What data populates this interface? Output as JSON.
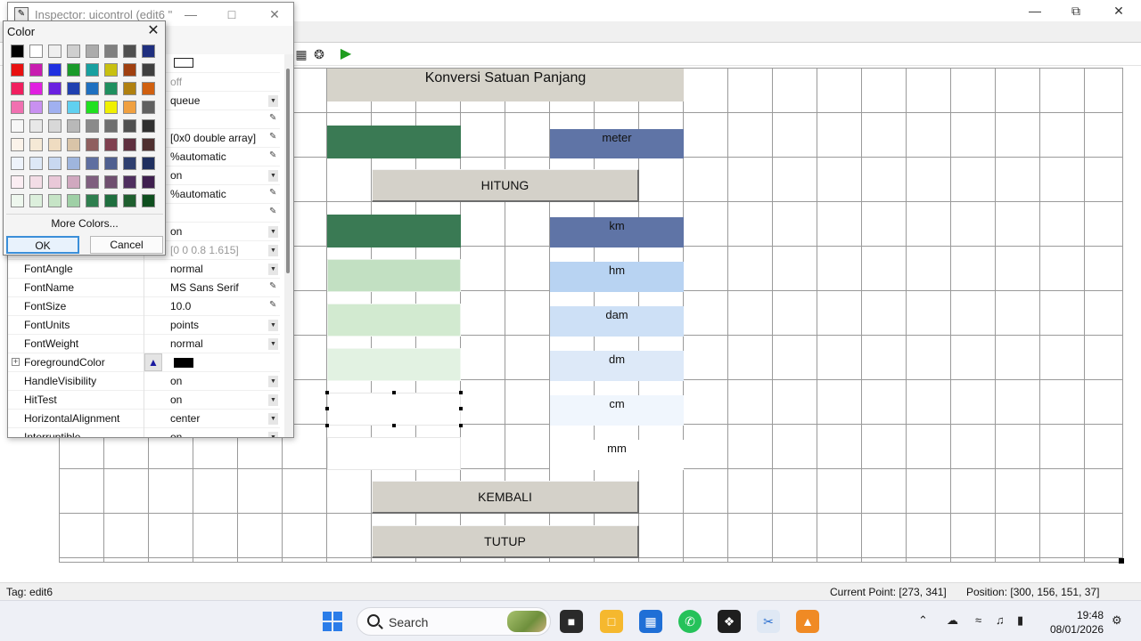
{
  "inspector": {
    "title": "Inspector:  uicontrol (edit6 \"",
    "rows": [
      {
        "name": "",
        "value": "",
        "control": "none",
        "swatch": "white"
      },
      {
        "name": "",
        "value": "off",
        "control": "none",
        "grey": true
      },
      {
        "name": "",
        "value": "queue",
        "control": "dropdown"
      },
      {
        "name": "",
        "value": "",
        "control": "edit"
      },
      {
        "name": "",
        "value": "[0x0  double array]",
        "control": "edit"
      },
      {
        "name": "",
        "value": "%automatic",
        "control": "edit"
      },
      {
        "name": "",
        "value": "on",
        "control": "dropdown"
      },
      {
        "name": "",
        "value": "%automatic",
        "control": "edit"
      },
      {
        "name": "",
        "value": "",
        "control": "edit"
      },
      {
        "name": "",
        "value": "on",
        "control": "dropdown"
      },
      {
        "name": "",
        "value": "[0 0 0.8 1.615]",
        "control": "dropdown",
        "grey": true
      },
      {
        "name": "FontAngle",
        "value": "normal",
        "control": "dropdown"
      },
      {
        "name": "FontName",
        "value": "MS Sans Serif",
        "control": "edit"
      },
      {
        "name": "FontSize",
        "value": "10.0",
        "control": "edit"
      },
      {
        "name": "FontUnits",
        "value": "points",
        "control": "dropdown"
      },
      {
        "name": "FontWeight",
        "value": "normal",
        "control": "dropdown"
      },
      {
        "name": "ForegroundColor",
        "value": "",
        "control": "none",
        "expand": true,
        "swatch": "black"
      },
      {
        "name": "HandleVisibility",
        "value": "on",
        "control": "dropdown"
      },
      {
        "name": "HitTest",
        "value": "on",
        "control": "dropdown"
      },
      {
        "name": "HorizontalAlignment",
        "value": "center",
        "control": "dropdown"
      },
      {
        "name": "Interruptible",
        "value": "on",
        "control": "dropdown"
      }
    ]
  },
  "color_picker": {
    "title": "Color",
    "more_colors": "More Colors...",
    "ok": "OK",
    "cancel": "Cancel",
    "swatches": [
      [
        "#000000",
        "#ffffff",
        "#efefef",
        "#cfcfcf",
        "#ababab",
        "#7f7f7f",
        "#4f4f4f",
        "#1f2f7f"
      ],
      [
        "#e81010",
        "#c81cb0",
        "#2030e0",
        "#1a9a2a",
        "#18a0a0",
        "#c8c010",
        "#a04010",
        "#3f3f3f"
      ],
      [
        "#f01f5f",
        "#e020e0",
        "#6a20e0",
        "#1f40b0",
        "#1f70c0",
        "#1f8f5f",
        "#b08010",
        "#d06010"
      ],
      [
        "#f070b0",
        "#c890f0",
        "#a0b0f0",
        "#60d0f0",
        "#20e020",
        "#f0f000",
        "#f0a040",
        "#606060"
      ],
      [
        "#f7f7f7",
        "#e8e8e8",
        "#d8d8d8",
        "#b8b8b8",
        "#8a8a8a",
        "#6f6f6f",
        "#505050",
        "#303030"
      ],
      [
        "#fbf3ea",
        "#f5e9d6",
        "#efdcc1",
        "#d9c4a8",
        "#8f5f5f",
        "#7f3f4f",
        "#5f2f3f",
        "#4f2f2f"
      ],
      [
        "#eef3fb",
        "#dde8f7",
        "#c8d8f0",
        "#9fb5dd",
        "#5f6fa0",
        "#4f5f8f",
        "#2f3f6f",
        "#1f2f5f"
      ],
      [
        "#fbeef3",
        "#f3dde6",
        "#e9c8d8",
        "#d0a8bf",
        "#7f5f7f",
        "#6f4f6f",
        "#4f2f5f",
        "#3f1f4f"
      ],
      [
        "#eef7ee",
        "#dcefdc",
        "#c6e4c6",
        "#9fd0a6",
        "#2f7f4f",
        "#1f6f3f",
        "#1f5f2f",
        "#0f4f1f"
      ]
    ]
  },
  "gui": {
    "title_label": "Konversi Satuan Panjang",
    "hitung": "HITUNG",
    "kembali": "KEMBALI",
    "tutup": "TUTUP",
    "labels": {
      "meter": "meter",
      "km": "km",
      "hm": "hm",
      "dam": "dam",
      "dm": "dm",
      "cm": "cm",
      "mm": "mm"
    },
    "colors": {
      "title_bg": "#d6d3ca",
      "input_meter": "#3a7a54",
      "out_km": "#3a7a54",
      "out_hm": "#c2e0c2",
      "out_dam": "#d2ead0",
      "out_dm": "#e2f2e2",
      "out_cm": "#ffffff",
      "out_mm": "#ffffff",
      "lbl_meter": "#5f74a6",
      "lbl_km": "#5f74a6",
      "lbl_hm": "#b8d3f2",
      "lbl_dam": "#cde0f6",
      "lbl_dm": "#dde9f8",
      "lbl_cm": "#f0f6fd",
      "lbl_mm": "#ffffff"
    }
  },
  "status": {
    "tag": "Tag: edit6",
    "current_point": "Current Point:  [273, 341]",
    "position": "Position: [300, 156, 151, 37]"
  },
  "taskbar": {
    "search_label": "Search",
    "time": "19:48",
    "date": "08/01/2026"
  }
}
